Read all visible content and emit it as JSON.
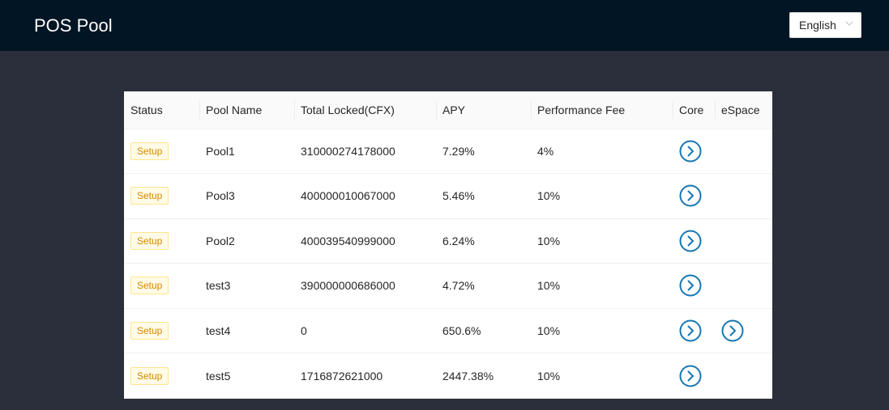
{
  "header": {
    "title": "POS Pool",
    "language": "English"
  },
  "table": {
    "columns": [
      "Status",
      "Pool Name",
      "Total Locked(CFX)",
      "APY",
      "Performance Fee",
      "Core",
      "eSpace"
    ],
    "rows": [
      {
        "status": "Setup",
        "name": "Pool1",
        "locked": "310000274178000",
        "apy": "7.29%",
        "fee": "4%",
        "core": true,
        "espace": false
      },
      {
        "status": "Setup",
        "name": "Pool3",
        "locked": "400000010067000",
        "apy": "5.46%",
        "fee": "10%",
        "core": true,
        "espace": false
      },
      {
        "status": "Setup",
        "name": "Pool2",
        "locked": "400039540999000",
        "apy": "6.24%",
        "fee": "10%",
        "core": true,
        "espace": false
      },
      {
        "status": "Setup",
        "name": "test3",
        "locked": "390000000686000",
        "apy": "4.72%",
        "fee": "10%",
        "core": true,
        "espace": false
      },
      {
        "status": "Setup",
        "name": "test4",
        "locked": "0",
        "apy": "650.6%",
        "fee": "10%",
        "core": true,
        "espace": true
      },
      {
        "status": "Setup",
        "name": "test5",
        "locked": "1716872621000",
        "apy": "2447.38%",
        "fee": "10%",
        "core": true,
        "espace": false
      }
    ]
  },
  "icons": {
    "go": "right-circle-icon",
    "dropdown": "chevron-down-icon"
  },
  "colors": {
    "header_bg": "#021524",
    "page_bg": "#2b2f3c",
    "accent": "#1677b3",
    "tag_text": "#d48806",
    "tag_bg": "#fffbe6",
    "tag_border": "#ffe58f"
  }
}
